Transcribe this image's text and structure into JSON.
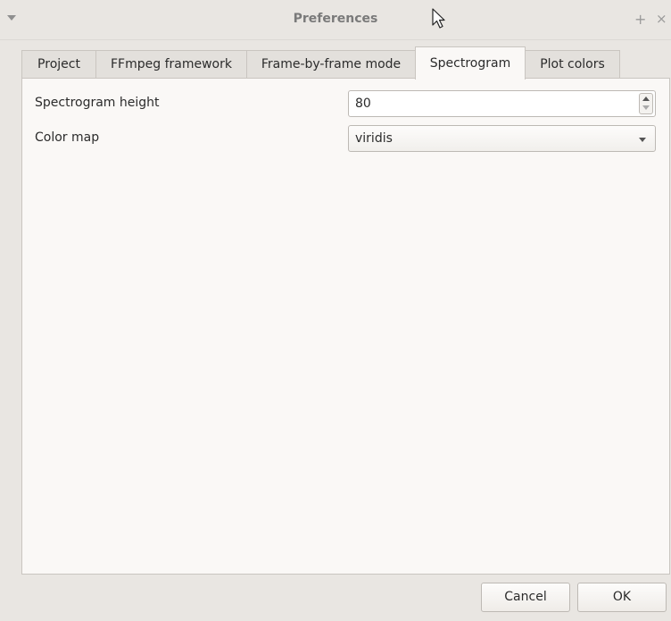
{
  "window": {
    "title": "Preferences",
    "menu_icon": "chevron-down-icon",
    "maximize_icon": "plus-icon",
    "close_icon": "close-icon",
    "maximize_glyph": "+",
    "close_glyph": "×"
  },
  "tabs": [
    {
      "label": "Project",
      "active": false
    },
    {
      "label": "FFmpeg framework",
      "active": false
    },
    {
      "label": "Frame-by-frame mode",
      "active": false
    },
    {
      "label": "Spectrogram",
      "active": true
    },
    {
      "label": "Plot colors",
      "active": false
    }
  ],
  "spectrogram": {
    "height_label": "Spectrogram height",
    "height_value": "80",
    "colormap_label": "Color map",
    "colormap_value": "viridis"
  },
  "buttons": {
    "cancel": "Cancel",
    "ok": "OK"
  }
}
